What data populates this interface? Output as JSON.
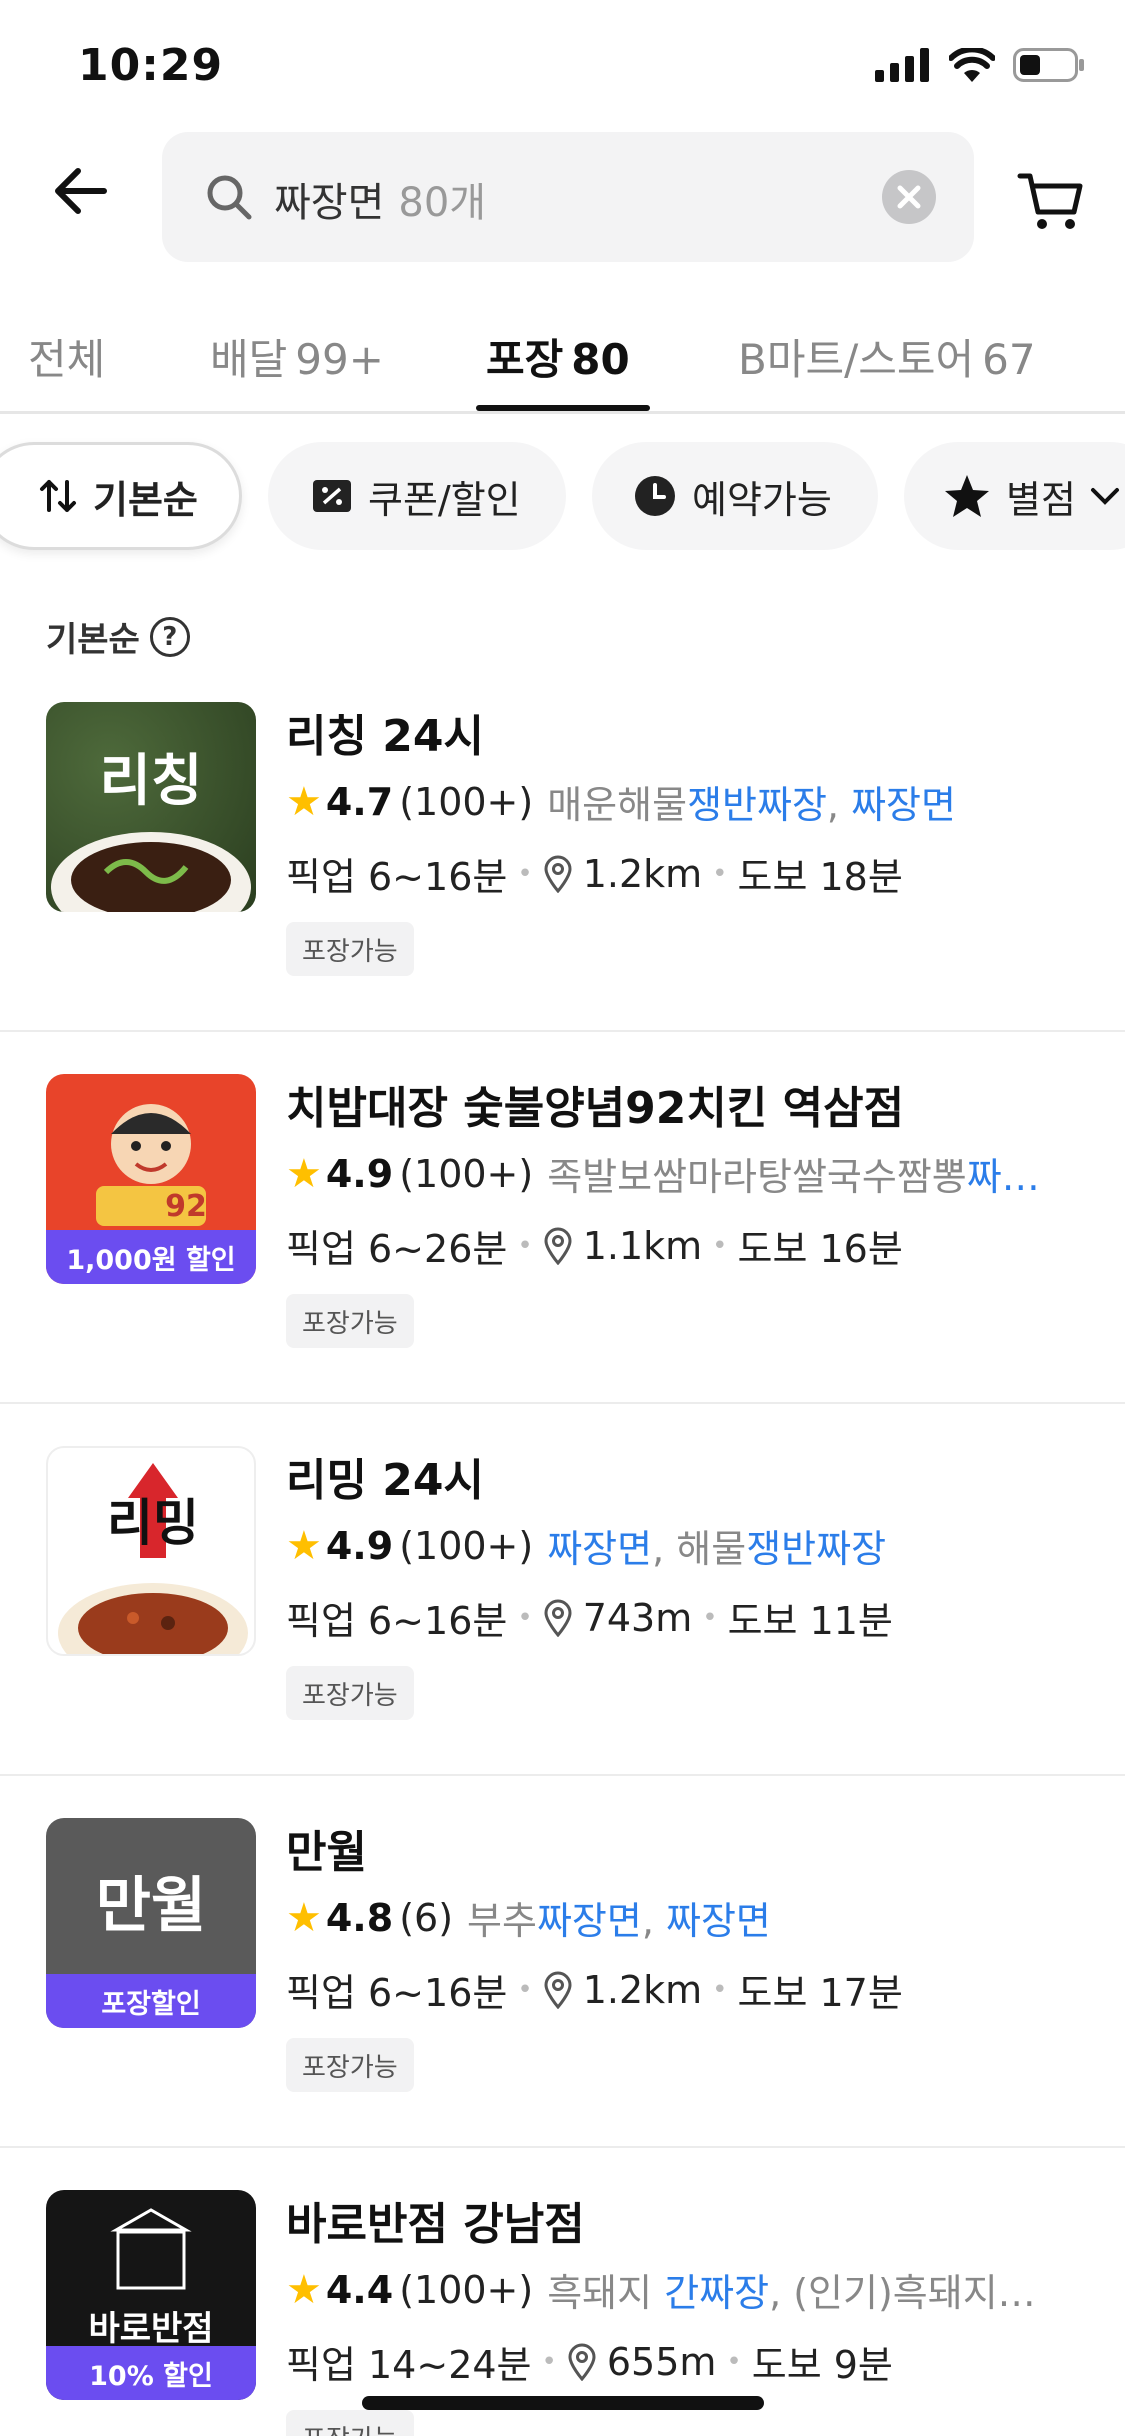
{
  "status": {
    "time": "10:29"
  },
  "search": {
    "query": "짜장면",
    "count": "80개"
  },
  "tabs": [
    {
      "label": "전체",
      "num": ""
    },
    {
      "label": "배달",
      "num": "99+"
    },
    {
      "label": "포장",
      "num": "80"
    },
    {
      "label": "B마트/스토어",
      "num": "67"
    }
  ],
  "filters": {
    "sort": "기본순",
    "coupon": "쿠폰/할인",
    "reserve": "예약가능",
    "rating": "별점"
  },
  "sort_label": "기본순",
  "stores": [
    {
      "name": "리칭 24시",
      "rating": "4.7",
      "reviews": "(100+)",
      "menu_plain": "매운해물",
      "menu_hl": "쟁반짜장",
      "menu_rest": ", ",
      "menu_hl2": "짜장면",
      "pickup": "픽업 6~16분",
      "distance": "1.2km",
      "walk": "도보 18분",
      "tag": "포장가능",
      "thumb_text": "리칭",
      "badge": ""
    },
    {
      "name": "치밥대장 숯불양념92치킨 역삼점",
      "rating": "4.9",
      "reviews": "(100+)",
      "menu_plain": "족발보쌈마라탕쌀국수짬뽕",
      "menu_hl": "짜…",
      "menu_rest": "",
      "menu_hl2": "",
      "pickup": "픽업 6~26분",
      "distance": "1.1km",
      "walk": "도보 16분",
      "tag": "포장가능",
      "thumb_text": "92",
      "badge": "1,000원 할인"
    },
    {
      "name": "리밍 24시",
      "rating": "4.9",
      "reviews": "(100+)",
      "menu_plain": "",
      "menu_hl": "짜장면",
      "menu_rest": ", 해물",
      "menu_hl2": "쟁반짜장",
      "pickup": "픽업 6~16분",
      "distance": "743m",
      "walk": "도보 11분",
      "tag": "포장가능",
      "thumb_text": "리밍",
      "badge": ""
    },
    {
      "name": "만월",
      "rating": "4.8",
      "reviews": "(6)",
      "menu_plain": "부추",
      "menu_hl": "짜장면",
      "menu_rest": ", ",
      "menu_hl2": "짜장면",
      "pickup": "픽업 6~16분",
      "distance": "1.2km",
      "walk": "도보 17분",
      "tag": "포장가능",
      "thumb_text": "만월",
      "badge": "포장할인"
    },
    {
      "name": "바로반점 강남점",
      "rating": "4.4",
      "reviews": "(100+)",
      "menu_plain": "흑돼지 ",
      "menu_hl": "간짜장",
      "menu_rest": ", (인기)흑돼지…",
      "menu_hl2": "",
      "pickup": "픽업 14~24분",
      "distance": "655m",
      "walk": "도보 9분",
      "tag": "포장가능",
      "thumb_text": "바로반점",
      "badge": "10% 할인"
    }
  ],
  "colors": {
    "accent": "#2b7de9",
    "badge": "#6b4df0",
    "star": "#ffbf00"
  }
}
